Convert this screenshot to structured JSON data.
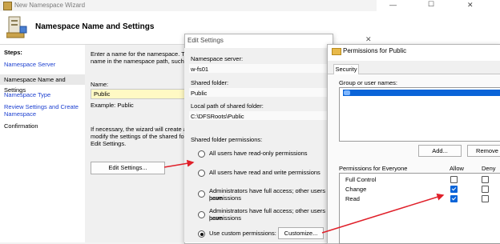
{
  "wizard": {
    "title": "New Namespace Wizard",
    "heading": "Namespace Name and Settings",
    "steps_label": "Steps:",
    "steps": [
      {
        "label": "Namespace Server"
      },
      {
        "label": "Namespace Name and Settings"
      },
      {
        "label": "Namespace Type"
      },
      {
        "label": "Review Settings and Create Namespace"
      },
      {
        "label": "Confirmation"
      }
    ],
    "intro_line1": "Enter a name for the namespace. This",
    "intro_line2": "name in the namespace path, such as",
    "name_label": "Name:",
    "name_value": "Public",
    "example_label": "Example: Public",
    "note_line1": "If necessary, the wizard will create a s",
    "note_line2": "modify the settings of the shared folde",
    "note_line3": "Edit Settings.",
    "edit_settings_button": "Edit Settings..."
  },
  "edit_settings": {
    "title": "Edit Settings",
    "close": "✕",
    "namespace_server_label": "Namespace server:",
    "namespace_server_value": "w-fs01",
    "shared_folder_label": "Shared folder:",
    "shared_folder_value": "Public",
    "local_path_label": "Local path of shared folder:",
    "local_path_value": "C:\\DFSRoots\\Public",
    "permissions_label": "Shared folder permissions:",
    "options": [
      {
        "line1": "All users have read-only permissions",
        "line2": "",
        "selected": false
      },
      {
        "line1": "All users have read and write permissions",
        "line2": "",
        "selected": false
      },
      {
        "line1": "Administrators have full access; other users have",
        "line2": "permissions",
        "selected": false
      },
      {
        "line1": "Administrators have full access; other users have",
        "line2": "permissions",
        "selected": false
      },
      {
        "line1": "Use custom permissions:",
        "line2": "",
        "selected": true
      }
    ],
    "customize_button": "Customize..."
  },
  "permissions": {
    "title": "Permissions for Public",
    "tab": "Security",
    "group_label": "Group or user names:",
    "add_button": "Add...",
    "remove_button": "Remove",
    "perm_header": "Permissions for Everyone",
    "allow_header": "Allow",
    "deny_header": "Deny",
    "rows": [
      {
        "name": "Full Control",
        "allow": false,
        "deny": false
      },
      {
        "name": "Change",
        "allow": true,
        "deny": false
      },
      {
        "name": "Read",
        "allow": true,
        "deny": false
      }
    ]
  },
  "window_controls": {
    "minimize": "—",
    "maximize": "☐",
    "close": "✕"
  },
  "colors": {
    "link": "#1b3fd0",
    "selection": "#0a64d8",
    "arrow": "#e0202a",
    "name_highlight": "#fff9c4"
  }
}
